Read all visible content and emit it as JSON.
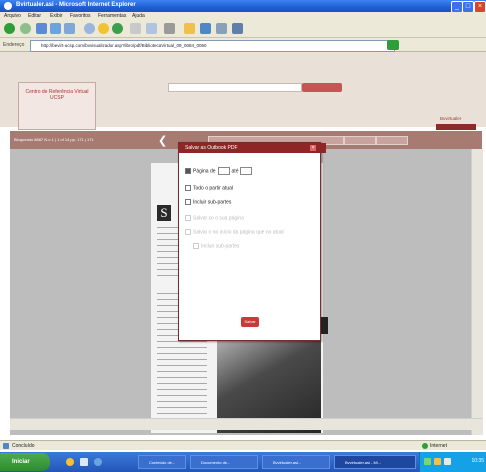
{
  "window": {
    "title": "Bvirtualer.asi - Microsoft Internet Explorer",
    "minimize": "_",
    "maximize": "□",
    "close": "×"
  },
  "menubar": {
    "items": [
      "Arquivo",
      "Editar",
      "Exibir",
      "Favoritos",
      "Ferramentas",
      "Ajuda"
    ]
  },
  "address": {
    "label": "Endereço",
    "url": "http://bevirt-ucsp.com/bvvisualizador.asp?libro/pdf/BibliotecaVirtual_09_0084_0060"
  },
  "site": {
    "logo_text": "Centro de Referência Virtual UCSP",
    "right_link": "Bvvirtualer",
    "nav_text": "Bloqueado 8887 N.o 1 | 1 of 14 pp. 171 | 171"
  },
  "modal": {
    "title": "Salvar as Outbook PDF",
    "close": "×",
    "options": [
      {
        "label": "Página de",
        "to_label": "até",
        "enabled": true,
        "checked": true
      },
      {
        "label": "Todo o partir atual",
        "enabled": true,
        "checked": false
      },
      {
        "label": "Incluir sub-partes",
        "enabled": true,
        "checked": false
      },
      {
        "label": "Salvar so o sua página",
        "enabled": false,
        "checked": false
      },
      {
        "label": "Salvar o no início da página que no atual",
        "enabled": false,
        "checked": false
      },
      {
        "label": "Incluir sub-partes",
        "enabled": false,
        "checked": false
      }
    ],
    "ok_label": "Salvar"
  },
  "document": {
    "drop_cap": "S"
  },
  "status": {
    "left": "Concluído",
    "right": "Internet"
  },
  "taskbar": {
    "start_label": "Iniciar",
    "tasks": [
      "Conteúdo de...",
      "Documento de...",
      "Bvvirtualer.asi...",
      "Bvvirtualer.asi - Mi..."
    ],
    "clock": "10:35"
  }
}
